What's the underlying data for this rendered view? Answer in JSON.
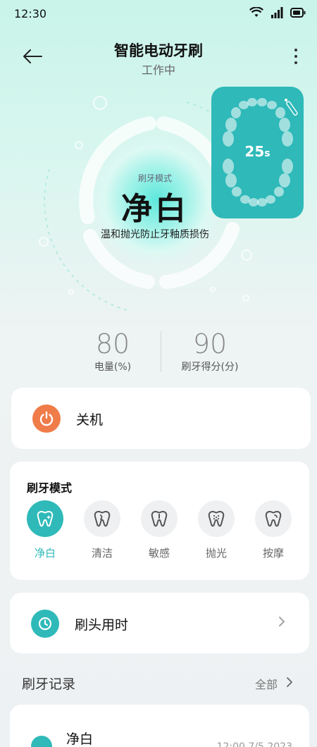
{
  "status_bar": {
    "time": "12:30"
  },
  "header": {
    "title": "智能电动牙刷",
    "subtitle": "工作中"
  },
  "hero": {
    "mode_caption": "刷牙模式",
    "mode_name": "净白",
    "mode_description": "温和抛光防止牙釉质损伤",
    "timer_value": "25",
    "timer_unit": "s"
  },
  "stats": [
    {
      "value": "80",
      "label": "电量(%)"
    },
    {
      "value": "90",
      "label": "刷牙得分(分)"
    }
  ],
  "power": {
    "label": "关机",
    "color": "#f07c4a"
  },
  "modes": {
    "title": "刷牙模式",
    "selected": "净白",
    "items": [
      {
        "label": "净白",
        "icon": "tooth-sparkle-icon"
      },
      {
        "label": "清洁",
        "icon": "tooth-clean-icon"
      },
      {
        "label": "敏感",
        "icon": "tooth-alert-icon"
      },
      {
        "label": "抛光",
        "icon": "tooth-polish-icon"
      },
      {
        "label": "按摩",
        "icon": "tooth-massage-icon"
      }
    ]
  },
  "brush_head": {
    "label": "刷头用时"
  },
  "records": {
    "title": "刷牙记录",
    "all_label": "全部",
    "items": [
      {
        "name": "净白",
        "time": "12:00 7/5 2023"
      }
    ]
  },
  "colors": {
    "accent": "#2fb9b9",
    "power": "#f07c4a",
    "background": "#eef1f3"
  }
}
